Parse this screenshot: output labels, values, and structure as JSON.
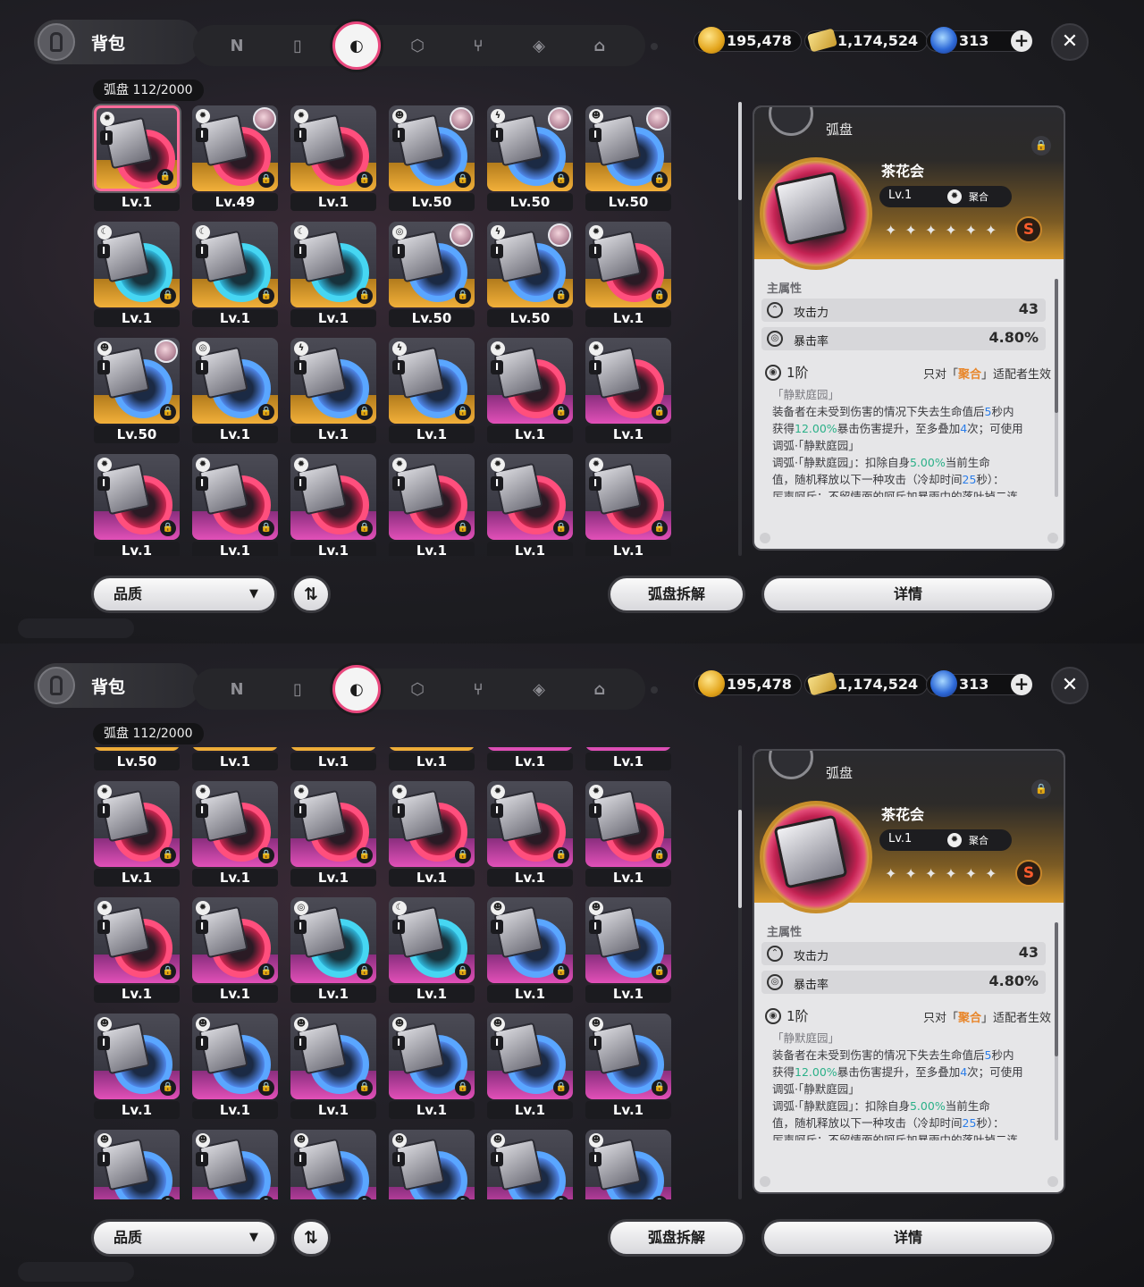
{
  "header": {
    "title": "背包",
    "tabs": [
      {
        "key": "agents",
        "glyph": "N",
        "icon": "agent-icon"
      },
      {
        "key": "device",
        "glyph": "▯",
        "icon": "device-icon"
      },
      {
        "key": "disc",
        "glyph": "◐",
        "icon": "disc-icon",
        "active": true
      },
      {
        "key": "box",
        "glyph": "⬡",
        "icon": "cube-icon"
      },
      {
        "key": "food",
        "glyph": "⑂",
        "icon": "utensils-icon"
      },
      {
        "key": "material",
        "glyph": "◈",
        "icon": "material-icon"
      },
      {
        "key": "home",
        "glyph": "⌂",
        "icon": "home-icon"
      }
    ],
    "currencies": [
      {
        "icon": "coin-icon",
        "value": "195,478"
      },
      {
        "icon": "ticket-icon",
        "value": "1,174,524"
      },
      {
        "icon": "gem-icon",
        "value": "313"
      }
    ],
    "close_glyph": "✕"
  },
  "inventory": {
    "label": "弧盘",
    "count": "112/2000"
  },
  "screen1_items": [
    {
      "lv": "Lv.1",
      "rar": "S",
      "disc": "pink",
      "attr": "✹",
      "selected": true
    },
    {
      "lv": "Lv.49",
      "rar": "S",
      "disc": "pink",
      "attr": "✹",
      "avatar": true
    },
    {
      "lv": "Lv.1",
      "rar": "S",
      "disc": "pink",
      "attr": "✹"
    },
    {
      "lv": "Lv.50",
      "rar": "S",
      "disc": "blue",
      "attr": "☻",
      "avatar": true
    },
    {
      "lv": "Lv.50",
      "rar": "S",
      "disc": "blue",
      "attr": "ϟ",
      "avatar": true
    },
    {
      "lv": "Lv.50",
      "rar": "S",
      "disc": "blue",
      "attr": "☻",
      "avatar": true
    },
    {
      "lv": "Lv.1",
      "rar": "S",
      "disc": "teal",
      "attr": "☾"
    },
    {
      "lv": "Lv.1",
      "rar": "S",
      "disc": "teal",
      "attr": "☾"
    },
    {
      "lv": "Lv.1",
      "rar": "S",
      "disc": "teal",
      "attr": "☾"
    },
    {
      "lv": "Lv.50",
      "rar": "S",
      "disc": "blue",
      "attr": "◎",
      "avatar": true
    },
    {
      "lv": "Lv.50",
      "rar": "S",
      "disc": "blue",
      "attr": "ϟ",
      "avatar": true
    },
    {
      "lv": "Lv.1",
      "rar": "S",
      "disc": "pink",
      "attr": "✹"
    },
    {
      "lv": "Lv.50",
      "rar": "S",
      "disc": "blue",
      "attr": "☻",
      "avatar": true
    },
    {
      "lv": "Lv.1",
      "rar": "S",
      "disc": "blue",
      "attr": "◎"
    },
    {
      "lv": "Lv.1",
      "rar": "S",
      "disc": "blue",
      "attr": "ϟ"
    },
    {
      "lv": "Lv.1",
      "rar": "S",
      "disc": "blue",
      "attr": "ϟ"
    },
    {
      "lv": "Lv.1",
      "rar": "A",
      "disc": "pink",
      "attr": "✹"
    },
    {
      "lv": "Lv.1",
      "rar": "A",
      "disc": "pink",
      "attr": "✹"
    },
    {
      "lv": "Lv.1",
      "rar": "A",
      "disc": "pink",
      "attr": "✹"
    },
    {
      "lv": "Lv.1",
      "rar": "A",
      "disc": "pink",
      "attr": "✹"
    },
    {
      "lv": "Lv.1",
      "rar": "A",
      "disc": "pink",
      "attr": "✹"
    },
    {
      "lv": "Lv.1",
      "rar": "A",
      "disc": "pink",
      "attr": "✹"
    },
    {
      "lv": "Lv.1",
      "rar": "A",
      "disc": "pink",
      "attr": "✹"
    },
    {
      "lv": "Lv.1",
      "rar": "A",
      "disc": "pink",
      "attr": "✹"
    }
  ],
  "screen2_items": [
    {
      "lv": "Lv.50",
      "rar": "S",
      "disc": "blue",
      "attr": "☻"
    },
    {
      "lv": "Lv.1",
      "rar": "S",
      "disc": "blue",
      "attr": "◎"
    },
    {
      "lv": "Lv.1",
      "rar": "S",
      "disc": "blue",
      "attr": "ϟ"
    },
    {
      "lv": "Lv.1",
      "rar": "S",
      "disc": "blue",
      "attr": "ϟ"
    },
    {
      "lv": "Lv.1",
      "rar": "A",
      "disc": "pink",
      "attr": "✹"
    },
    {
      "lv": "Lv.1",
      "rar": "A",
      "disc": "pink",
      "attr": "✹"
    },
    {
      "lv": "Lv.1",
      "rar": "A",
      "disc": "pink",
      "attr": "✹"
    },
    {
      "lv": "Lv.1",
      "rar": "A",
      "disc": "pink",
      "attr": "✹"
    },
    {
      "lv": "Lv.1",
      "rar": "A",
      "disc": "pink",
      "attr": "✹"
    },
    {
      "lv": "Lv.1",
      "rar": "A",
      "disc": "pink",
      "attr": "✹"
    },
    {
      "lv": "Lv.1",
      "rar": "A",
      "disc": "pink",
      "attr": "✹"
    },
    {
      "lv": "Lv.1",
      "rar": "A",
      "disc": "pink",
      "attr": "✹"
    },
    {
      "lv": "Lv.1",
      "rar": "A",
      "disc": "pink",
      "attr": "✹"
    },
    {
      "lv": "Lv.1",
      "rar": "A",
      "disc": "pink",
      "attr": "✹"
    },
    {
      "lv": "Lv.1",
      "rar": "A",
      "disc": "teal",
      "attr": "◎"
    },
    {
      "lv": "Lv.1",
      "rar": "A",
      "disc": "teal",
      "attr": "☾"
    },
    {
      "lv": "Lv.1",
      "rar": "A",
      "disc": "blue",
      "attr": "☻"
    },
    {
      "lv": "Lv.1",
      "rar": "A",
      "disc": "blue",
      "attr": "☻"
    },
    {
      "lv": "Lv.1",
      "rar": "A",
      "disc": "blue",
      "attr": "☻"
    },
    {
      "lv": "Lv.1",
      "rar": "A",
      "disc": "blue",
      "attr": "☻"
    },
    {
      "lv": "Lv.1",
      "rar": "A",
      "disc": "blue",
      "attr": "☻"
    },
    {
      "lv": "Lv.1",
      "rar": "A",
      "disc": "blue",
      "attr": "☻"
    },
    {
      "lv": "Lv.1",
      "rar": "A",
      "disc": "blue",
      "attr": "☻"
    },
    {
      "lv": "Lv.1",
      "rar": "A",
      "disc": "blue",
      "attr": "☻"
    },
    {
      "lv": "",
      "rar": "A",
      "disc": "blue",
      "attr": "☻"
    },
    {
      "lv": "",
      "rar": "A",
      "disc": "blue",
      "attr": "☻"
    },
    {
      "lv": "",
      "rar": "A",
      "disc": "blue",
      "attr": "☻"
    },
    {
      "lv": "",
      "rar": "A",
      "disc": "blue",
      "attr": "☻"
    },
    {
      "lv": "",
      "rar": "A",
      "disc": "blue",
      "attr": "☻"
    },
    {
      "lv": "",
      "rar": "A",
      "disc": "blue",
      "attr": "☻"
    }
  ],
  "tier_glyph": "I",
  "lock_glyph": "🔒",
  "detail": {
    "type_label": "弧盘",
    "name": "茶花会",
    "level": "Lv.1",
    "specialty_icon": "✹",
    "specialty": "聚合",
    "stars": "✦✦✦✦✦✦",
    "rank": "S",
    "main_title": "主属性",
    "stats": [
      {
        "icon": "⌃",
        "name": "攻击力",
        "value": "43"
      },
      {
        "icon": "◎",
        "name": "暴击率",
        "value": "4.80%"
      }
    ],
    "tier": "1阶",
    "condition_prefix": "只对「",
    "condition_hl": "聚合",
    "condition_suffix": "」适配者生效",
    "desc_title": "「静默庭园」",
    "desc_lines": [
      [
        {
          "t": "装备者在未受到伤害的情况下失去生命值后"
        },
        {
          "t": "5",
          "c": "b"
        },
        {
          "t": "秒内"
        }
      ],
      [
        {
          "t": "获得"
        },
        {
          "t": "12.00%",
          "c": "g"
        },
        {
          "t": "暴击伤害提升，至多叠加"
        },
        {
          "t": "4",
          "c": "b"
        },
        {
          "t": "次；可使用"
        }
      ],
      [
        {
          "t": "调弧·「静默庭园」"
        }
      ],
      [
        {
          "t": "调弧·「静默庭园」：扣除自身"
        },
        {
          "t": "5.00%",
          "c": "g"
        },
        {
          "t": "当前生命"
        }
      ],
      [
        {
          "t": "值，随机释放以下一种攻击（冷却时间"
        },
        {
          "t": "25",
          "c": "b"
        },
        {
          "t": "秒）："
        }
      ],
      [
        {
          "t": "厉声呵斥：不留情面的呵斥加暴雨中的落叶掉二连"
        }
      ]
    ]
  },
  "buttons": {
    "quality": "品质",
    "quality_caret": "▼",
    "sort_glyph": "⇅",
    "dismantle": "弧盘拆解",
    "details": "详情"
  },
  "colors": {
    "accent_pink": "#e9487e",
    "rarity_S": "#f2b03a",
    "rarity_A": "#e250b8",
    "highlight_orange": "#e8862a",
    "value_green": "#2bb088",
    "value_blue": "#2b7de9"
  }
}
